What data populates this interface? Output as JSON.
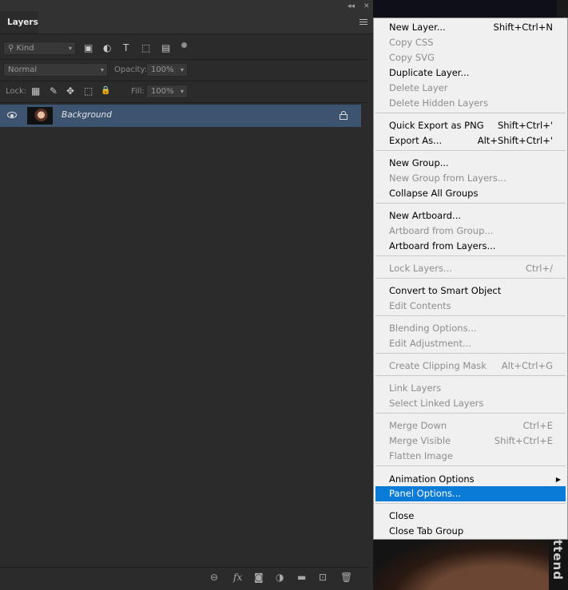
{
  "panel": {
    "title": "Layers",
    "collapse_glyph": "◂◂",
    "close_glyph": "✕",
    "filter": {
      "kind_label": "Kind",
      "search_icon": "search-icon"
    },
    "blend_mode": "Normal",
    "opacity_label": "Opacity:",
    "opacity_value": "100%",
    "lock_label": "Lock:",
    "fill_label": "Fill:",
    "fill_value": "100%",
    "layers": [
      {
        "name": "Background",
        "visible": true,
        "locked": true
      }
    ]
  },
  "icons": {
    "filter_pixel": "▣",
    "filter_adjust": "◐",
    "filter_type": "T",
    "filter_shape": "⬚",
    "filter_smart": "▤",
    "lock_transparent": "▦",
    "lock_paint": "✎",
    "lock_move": "✥",
    "lock_artboard": "⬚",
    "lock_all": "🔒",
    "link": "⊖",
    "fx": "fx",
    "mask": "◙",
    "adjustment": "◑",
    "group": "▬",
    "new_layer": "⊡",
    "delete": "🗑"
  },
  "doc_side_text": "ttend",
  "menu": {
    "accent": "#0a7bd7",
    "items": [
      {
        "label": "New Layer...",
        "shortcut": "Shift+Ctrl+N",
        "disabled": false
      },
      {
        "label": "Copy CSS",
        "shortcut": "",
        "disabled": true
      },
      {
        "label": "Copy SVG",
        "shortcut": "",
        "disabled": true
      },
      {
        "label": "Duplicate Layer...",
        "shortcut": "",
        "disabled": false
      },
      {
        "label": "Delete Layer",
        "shortcut": "",
        "disabled": true
      },
      {
        "label": "Delete Hidden Layers",
        "shortcut": "",
        "disabled": true
      },
      {
        "label": "Quick Export as PNG",
        "shortcut": "Shift+Ctrl+'",
        "disabled": false
      },
      {
        "label": "Export As...",
        "shortcut": "Alt+Shift+Ctrl+'",
        "disabled": false
      },
      {
        "label": "New Group...",
        "shortcut": "",
        "disabled": false
      },
      {
        "label": "New Group from Layers...",
        "shortcut": "",
        "disabled": true
      },
      {
        "label": "Collapse All Groups",
        "shortcut": "",
        "disabled": false
      },
      {
        "label": "New Artboard...",
        "shortcut": "",
        "disabled": false
      },
      {
        "label": "Artboard from Group...",
        "shortcut": "",
        "disabled": true
      },
      {
        "label": "Artboard from Layers...",
        "shortcut": "",
        "disabled": false
      },
      {
        "label": "Lock Layers...",
        "shortcut": "Ctrl+/",
        "disabled": true
      },
      {
        "label": "Convert to Smart Object",
        "shortcut": "",
        "disabled": false
      },
      {
        "label": "Edit Contents",
        "shortcut": "",
        "disabled": true
      },
      {
        "label": "Blending Options...",
        "shortcut": "",
        "disabled": true
      },
      {
        "label": "Edit Adjustment...",
        "shortcut": "",
        "disabled": true
      },
      {
        "label": "Create Clipping Mask",
        "shortcut": "Alt+Ctrl+G",
        "disabled": true
      },
      {
        "label": "Link Layers",
        "shortcut": "",
        "disabled": true
      },
      {
        "label": "Select Linked Layers",
        "shortcut": "",
        "disabled": true
      },
      {
        "label": "Merge Down",
        "shortcut": "Ctrl+E",
        "disabled": true
      },
      {
        "label": "Merge Visible",
        "shortcut": "Shift+Ctrl+E",
        "disabled": true
      },
      {
        "label": "Flatten Image",
        "shortcut": "",
        "disabled": true
      },
      {
        "label": "Animation Options",
        "shortcut": "",
        "disabled": false,
        "submenu": true
      },
      {
        "label": "Panel Options...",
        "shortcut": "",
        "disabled": false,
        "highlighted": true
      },
      {
        "label": "Close",
        "shortcut": "",
        "disabled": false
      },
      {
        "label": "Close Tab Group",
        "shortcut": "",
        "disabled": false
      }
    ]
  }
}
